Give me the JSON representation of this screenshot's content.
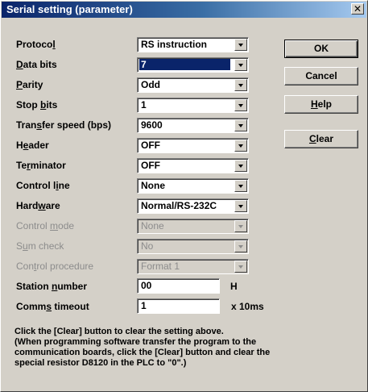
{
  "window": {
    "title": "Serial setting (parameter)",
    "close_glyph": "✕"
  },
  "settings": [
    {
      "label": "Protocol",
      "value": "RS instruction",
      "enabled": true,
      "selected": false
    },
    {
      "label": "Data bits",
      "value": "7",
      "enabled": true,
      "selected": true
    },
    {
      "label": "Parity",
      "value": "Odd",
      "enabled": true,
      "selected": false
    },
    {
      "label": "Stop bits",
      "value": "1",
      "enabled": true,
      "selected": false
    },
    {
      "label": "Transfer speed (bps)",
      "value": "9600",
      "enabled": true,
      "selected": false
    },
    {
      "label": "Header",
      "value": "OFF",
      "enabled": true,
      "selected": false
    },
    {
      "label": "Terminator",
      "value": "OFF",
      "enabled": true,
      "selected": false
    },
    {
      "label": "Control line",
      "value": "None",
      "enabled": true,
      "selected": false
    },
    {
      "label": "Hardware",
      "value": "Normal/RS-232C",
      "enabled": true,
      "selected": false
    },
    {
      "label": "Control mode",
      "value": "None",
      "enabled": false,
      "selected": false
    },
    {
      "label": "Sum check",
      "value": "No",
      "enabled": false,
      "selected": false
    },
    {
      "label": "Control procedure",
      "value": "Format 1",
      "enabled": false,
      "selected": false
    }
  ],
  "station": {
    "label": "Station number",
    "value": "00",
    "unit": "H"
  },
  "timeout": {
    "label": "Comms timeout",
    "value": "1",
    "unit": "x 10ms"
  },
  "buttons": {
    "ok": "OK",
    "cancel": "Cancel",
    "help": "Help",
    "clear": "Clear"
  },
  "info": {
    "lines": [
      "Click the [Clear] button to clear the setting above.",
      "(When programming software transfer the program to the",
      "communication boards, click the [Clear] button and clear the",
      "special resistor D8120 in the PLC to \"0\".)"
    ]
  }
}
